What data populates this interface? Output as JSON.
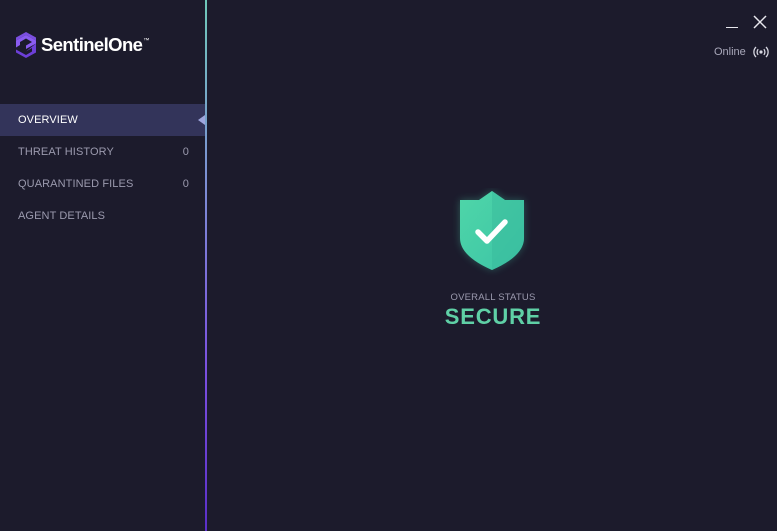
{
  "brand": {
    "name": "SentinelOne",
    "trademark": "™"
  },
  "window": {
    "minimize_icon": "minimize-icon",
    "close_icon": "close-icon"
  },
  "connection": {
    "status": "Online",
    "icon": "broadcast-icon"
  },
  "sidebar": {
    "items": [
      {
        "label": "OVERVIEW",
        "count": "",
        "active": true
      },
      {
        "label": "THREAT HISTORY",
        "count": "0",
        "active": false
      },
      {
        "label": "QUARANTINED FILES",
        "count": "0",
        "active": false
      },
      {
        "label": "AGENT DETAILS",
        "count": "",
        "active": false
      }
    ]
  },
  "main": {
    "status_icon": "shield-check-icon",
    "status_label": "OVERALL STATUS",
    "status_value": "SECURE"
  },
  "colors": {
    "background": "#1c1b2c",
    "active_item": "#33345a",
    "secure_green": "#5fd0a6",
    "brand_purple": "#7b4fe0"
  }
}
